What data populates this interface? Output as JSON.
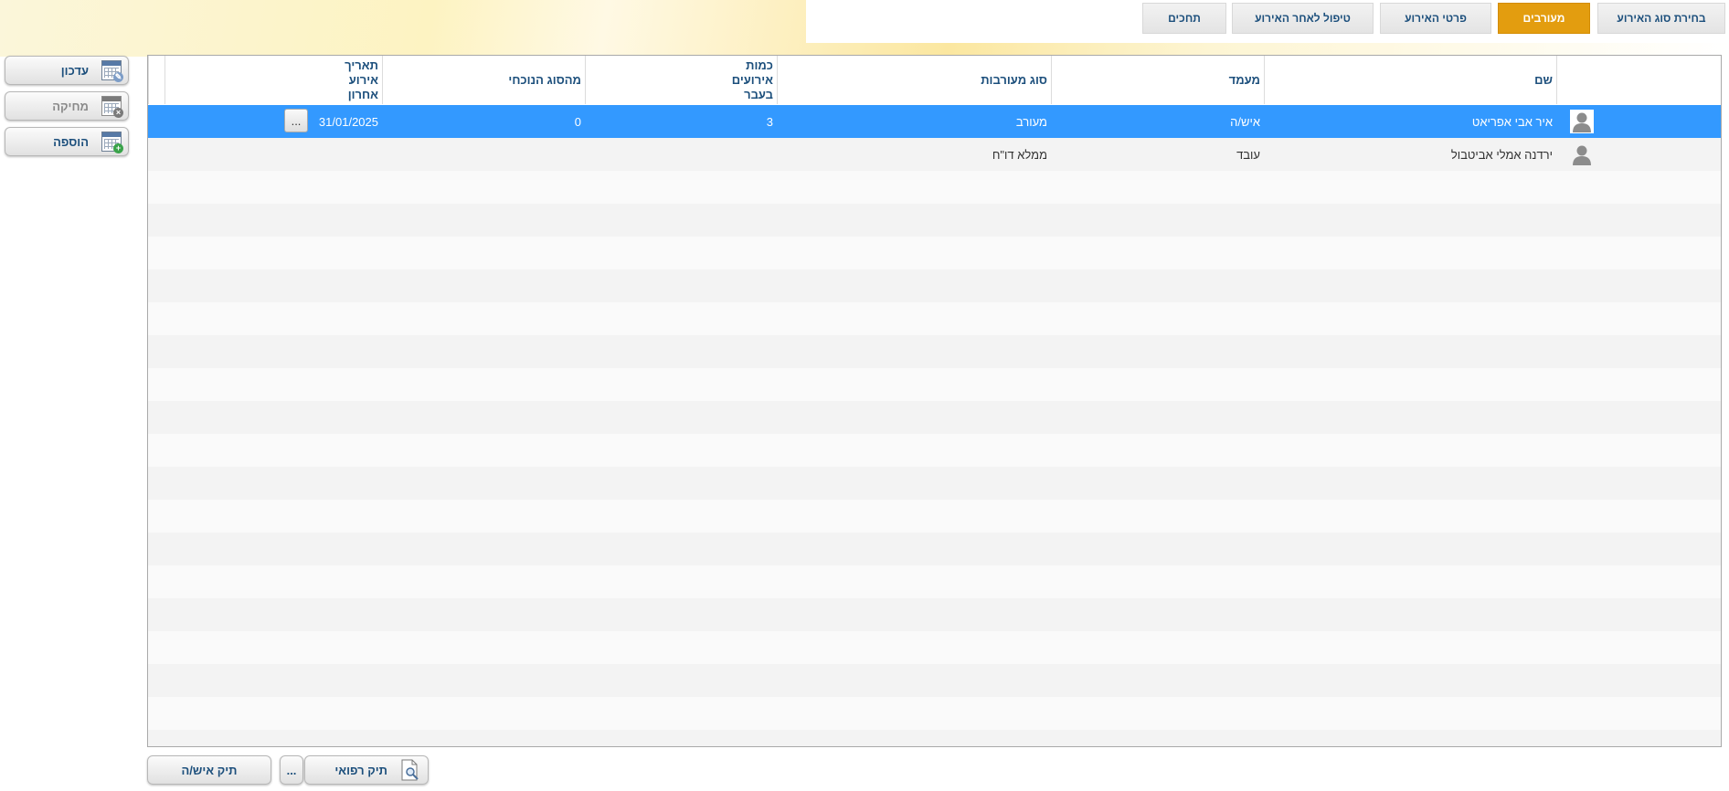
{
  "tabs": [
    {
      "label": "בחירת סוג האירוע",
      "active": false
    },
    {
      "label": "מעורבים",
      "active": true
    },
    {
      "label": "פרטי האירוע",
      "active": false
    },
    {
      "label": "טיפול לאחר האירוע",
      "active": false
    },
    {
      "label": "תחכים",
      "active": false
    }
  ],
  "side_buttons": {
    "update": "עדכון",
    "delete": "מחיקה",
    "add": "הוספה"
  },
  "grid": {
    "columns": {
      "name": "שם",
      "status": "מעמד",
      "involvement_type": "סוג מעורבות",
      "past_events_count": "כמות אירועים בעבר",
      "current_type": "מהסוג הנוכחי",
      "last_event_date": "תאריך אירוע אחרון"
    },
    "rows": [
      {
        "name": "איר אבי אפריאט",
        "status": "איש/ה",
        "involvement_type": "מעורב",
        "past_events_count": "3",
        "current_type": "0",
        "last_event_date": "31/01/2025",
        "selected": true
      },
      {
        "name": "ירדנה אמלי אביטבול",
        "status": "עובד",
        "involvement_type": "ממלא דו\"ח",
        "past_events_count": "",
        "current_type": "",
        "last_event_date": "",
        "selected": false
      }
    ],
    "ellipsis_label": "..."
  },
  "bottom_buttons": {
    "medical_file": "תיק רפואי",
    "ellipsis": "...",
    "personal_file": "תיק איש/ה"
  },
  "colors": {
    "accent": "#e39d0f",
    "selected_row": "#3399ff",
    "header_text": "#1c4f7c"
  }
}
